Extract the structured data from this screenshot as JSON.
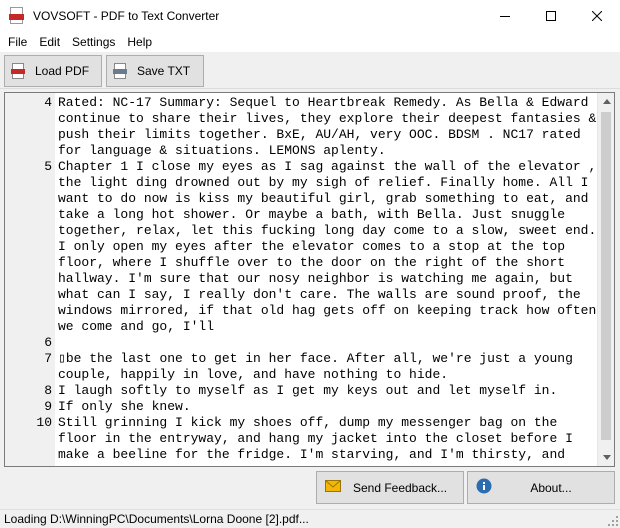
{
  "app": {
    "title": "VOVSOFT - PDF to Text Converter",
    "icon": "pdf-app-icon",
    "window_controls": [
      "minimize-icon",
      "maximize-icon",
      "close-icon"
    ]
  },
  "menu": {
    "items": [
      "File",
      "Edit",
      "Settings",
      "Help"
    ]
  },
  "toolbar": {
    "load_label": "Load PDF",
    "load_icon": "pdf-file-icon",
    "save_label": "Save TXT",
    "save_icon": "txt-file-icon"
  },
  "editor": {
    "lines": [
      {
        "num": "4",
        "text": "Rated: NC-17 Summary: Sequel to Heartbreak Remedy. As Bella & Edward continue to share their lives, they explore their deepest fantasies & push their limits together. BxE, AU/AH, very OOC. BDSM . NC17 rated for language & situations. LEMONS aplenty."
      },
      {
        "num": "5",
        "text": "Chapter 1 I close my eyes as I sag against the wall of the elevator , the light ding drowned out by my sigh of relief. Finally home. All I want to do now is kiss my beautiful girl, grab something to eat, and take a long hot shower. Or maybe a bath, with Bella. Just snuggle together, relax, let this fucking long day come to a slow, sweet end. I only open my eyes after the elevator comes to a stop at the top floor, where I shuffle over to the door on the right of the short hallway. I'm sure that our nosy neighbor is watching me again, but what can I say, I really don't care. The walls are sound proof, the windows mirrored, if that old hag gets off on keeping track how often we come and go, I'll"
      },
      {
        "num": "6",
        "text": ""
      },
      {
        "num": "7",
        "text": "▯be the last one to get in her face. After all, we're just a young couple, happily in love, and have nothing to hide."
      },
      {
        "num": "8",
        "text": "I laugh softly to myself as I get my keys out and let myself in."
      },
      {
        "num": "9",
        "text": "If only she knew."
      },
      {
        "num": "10",
        "text": "Still grinning I kick my shoes off, dump my messenger bag on the floor in the entryway, and hang my jacket into the closet before I make a beeline for the fridge. I'm starving, and I'm thirsty, and"
      }
    ]
  },
  "bottom": {
    "feedback_label": "Send Feedback...",
    "feedback_icon": "envelope-icon",
    "about_label": "About...",
    "about_icon": "info-icon"
  },
  "status": {
    "text": "Loading D:\\WinningPC\\Documents\\Lorna Doone [2].pdf..."
  },
  "colors": {
    "window_bg": "#f0f0f0",
    "button_bg": "#e1e1e1",
    "button_border": "#adadad",
    "pdf_red": "#c62828",
    "info_blue": "#2b6cb0",
    "envelope_yellow": "#f2b705"
  }
}
